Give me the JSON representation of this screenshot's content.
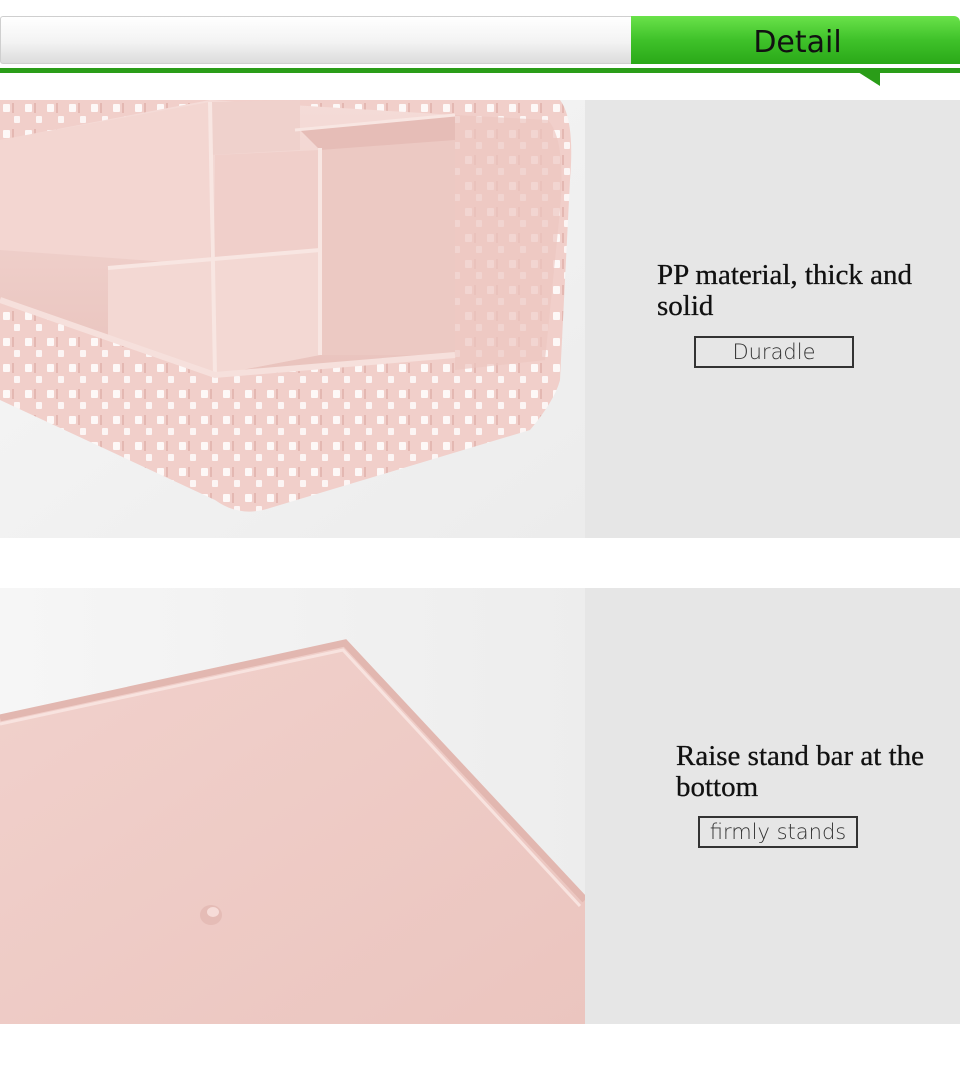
{
  "header": {
    "tab_label": "Detail",
    "accent_color": "#3fc22a"
  },
  "features": [
    {
      "title": "PP material, thick and solid",
      "badge": "Duradle",
      "image": "pink-woven-organizer-compartments"
    },
    {
      "title": "Raise stand bar at the bottom",
      "badge": "firmly stands",
      "image": "pink-organizer-bottom-view"
    }
  ],
  "colors": {
    "panel_background": "#e6e6e6",
    "product_pink": "#f2d2cd"
  }
}
